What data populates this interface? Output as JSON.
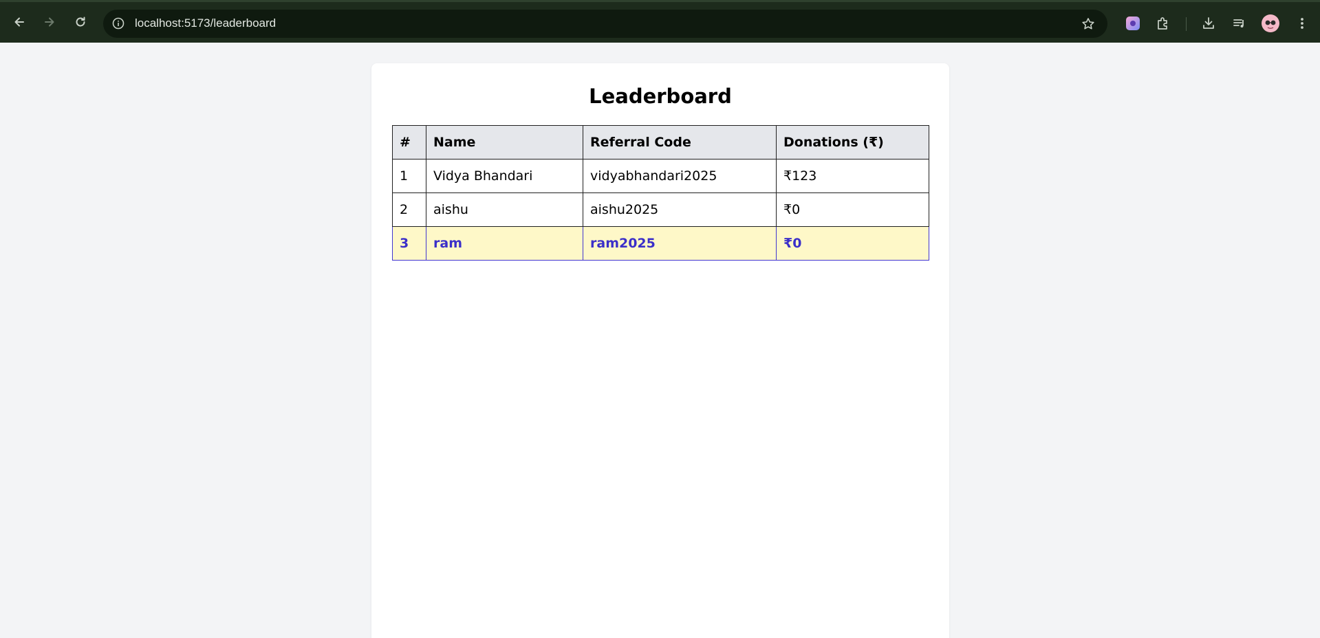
{
  "browser": {
    "url": "localhost:5173/leaderboard",
    "icons": {
      "back": "back-arrow-icon",
      "forward": "forward-arrow-icon",
      "reload": "reload-icon",
      "site_info": "site-info-icon",
      "bookmark": "star-icon",
      "extension_app": "extension-app-icon",
      "extensions": "puzzle-icon",
      "downloads": "download-icon",
      "media": "media-queue-icon",
      "profile": "avatar",
      "menu": "kebab-menu-icon"
    }
  },
  "leaderboard": {
    "title": "Leaderboard",
    "columns": [
      "#",
      "Name",
      "Referral Code",
      "Donations (₹)"
    ],
    "rows": [
      {
        "rank": "1",
        "name": "Vidya Bhandari",
        "code": "vidyabhandari2025",
        "donations": "₹123"
      },
      {
        "rank": "2",
        "name": "aishu",
        "code": "aishu2025",
        "donations": "₹0"
      },
      {
        "rank": "3",
        "name": "ram",
        "code": "ram2025",
        "donations": "₹0"
      }
    ]
  },
  "colors": {
    "chrome_bg": "#1d2b1c",
    "page_bg": "#f3f4f6",
    "header_bg": "#e5e7eb",
    "highlight_bg": "#fef8c8",
    "highlight_text": "#3b2fc9"
  }
}
